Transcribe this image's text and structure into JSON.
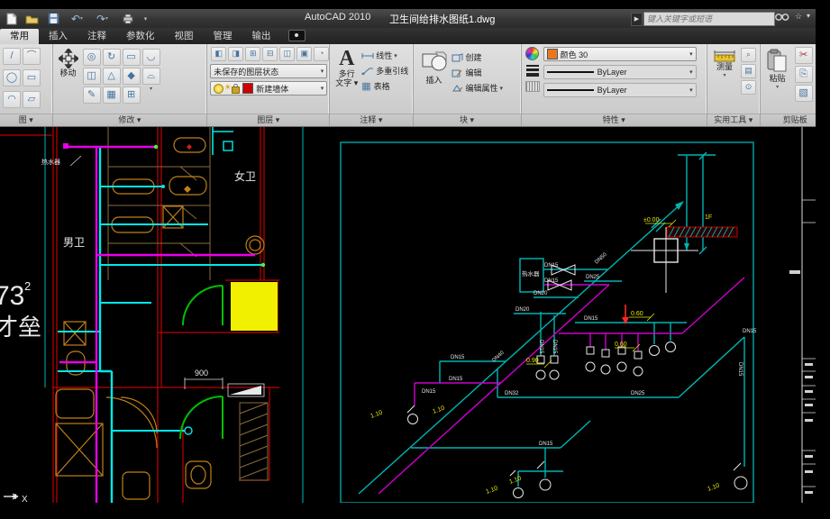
{
  "window": {
    "app": "AutoCAD 2010",
    "doc": "卫生间给排水图纸1.dwg"
  },
  "search": {
    "placeholder": "键入关键字或短语"
  },
  "ribbon": {
    "tabs": [
      {
        "label": "常用",
        "active": true
      },
      {
        "label": "插入"
      },
      {
        "label": "注释"
      },
      {
        "label": "参数化"
      },
      {
        "label": "视图"
      },
      {
        "label": "管理"
      },
      {
        "label": "输出"
      }
    ],
    "draw": {
      "label": "图 ▾"
    },
    "modify": {
      "label": "修改 ▾",
      "move": "移动"
    },
    "layers": {
      "label": "图层 ▾",
      "state": "未保存的图层状态",
      "current": "新建墙体"
    },
    "annotate": {
      "label": "注释 ▾",
      "mtext_1": "多行",
      "mtext_2": "文字 ▾",
      "linear": "线性",
      "mleader": "多重引线",
      "table": "表格"
    },
    "block": {
      "label": "块 ▾",
      "insert": "插入",
      "create": "创建",
      "edit": "编辑",
      "edit_attr": "编辑属性"
    },
    "props": {
      "label": "特性 ▾",
      "color": "颜色 30",
      "linetype": "ByLayer",
      "lineweight": "ByLayer"
    },
    "utils": {
      "label": "实用工具 ▾",
      "measure": "测量"
    },
    "clipboard": {
      "label": "剪贴板",
      "paste": "粘贴"
    }
  },
  "drawing": {
    "plan": {
      "female": "女卫",
      "male": "男卫",
      "heater": "热水器",
      "dim": "900",
      "area_num": "73",
      "area_sup": "2",
      "area_text": "才垒"
    },
    "iso": {
      "heater": "热水器",
      "floor": "1F",
      "dn": [
        "DN15",
        "DN15",
        "DN50",
        "DN40",
        "DN32",
        "DN20",
        "DN20",
        "DN25",
        "DN15",
        "DN15",
        "DN15",
        "DN15",
        "DN15",
        "DN15",
        "DN15",
        "DN15",
        "DN15",
        "DN25"
      ],
      "elev": [
        "±0.00",
        "0.60",
        "0.60",
        "0.90",
        "1.10",
        "1.10",
        "1.10",
        "1.10",
        "1.10"
      ]
    },
    "ucs": {
      "x": "X"
    }
  },
  "colors": {
    "pipe_cold": "#00e8e8",
    "pipe_hot": "#e800e8",
    "wall": "#c00000",
    "fixture": "#c08018",
    "highlight": "#f0f000",
    "iso_line": "#00b4b4",
    "elevation_text": "#e8e800",
    "swatch_color30": "#e87820",
    "layer_color": "#cc0000"
  }
}
